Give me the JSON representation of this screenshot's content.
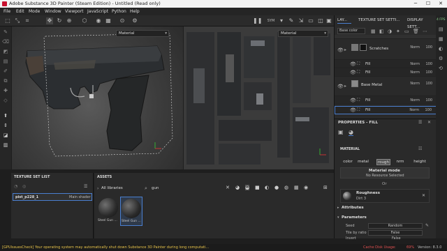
{
  "window": {
    "title": "Adobe Substance 3D Painter (Steam Edition) - Untitled (Read only)",
    "minimize": "─",
    "maximize": "☐",
    "close": "✕"
  },
  "menu": [
    "File",
    "Edit",
    "Mode",
    "Window",
    "Viewport",
    "JavaScript",
    "Python",
    "Help"
  ],
  "viewport3d": {
    "channel_select": "Material"
  },
  "viewport2d": {
    "channel_select": "Material"
  },
  "toolbar": {
    "sym_label": "SYM"
  },
  "layers": {
    "tabs": [
      "LAY...",
      "TEXTURE SET SETTI...",
      "DISPLAY SETT..."
    ],
    "channel_select": "Base color",
    "fps": "4 FPS",
    "rows": [
      {
        "name": "Scratches",
        "blend": "Norm",
        "opacity": "100"
      },
      {
        "name": "Fill",
        "blend": "Norm",
        "opacity": "100"
      },
      {
        "name": "Fill",
        "blend": "Norm",
        "opacity": "100"
      },
      {
        "name": "Base Metal",
        "blend": "Norm",
        "opacity": "100"
      },
      {
        "name": "Fill",
        "blend": "Norm",
        "opacity": "100"
      },
      {
        "name": "Fill",
        "blend": "Norm",
        "opacity": "100"
      }
    ]
  },
  "properties": {
    "title": "PROPERTIES - FILL",
    "material_label": "MATERIAL",
    "channels": [
      "color",
      "metal",
      "rough",
      "nrm",
      "height"
    ],
    "material_mode": "Material mode",
    "no_resource": "No Resource Selected",
    "or_label": "Or",
    "roughness_label": "Roughness",
    "roughness_value": "Dirt 3",
    "attributes_label": "Attributes",
    "parameters_label": "Parameters",
    "seed_label": "Seed",
    "seed_value": "Random",
    "tile_label": "Tile by ratio",
    "tile_value": "False",
    "invert_label": "Invert",
    "invert_value": "False"
  },
  "texture_set_list": {
    "title": "TEXTURE SET LIST",
    "item": "pist_p228_1",
    "shader": "Main shader"
  },
  "assets": {
    "title": "ASSETS",
    "library": "All libraries",
    "search": "gun",
    "items": [
      "Steel Gun ...",
      "Steel Gun ..."
    ]
  },
  "status": {
    "message": "[GPUIssuesCheck] Your operating system may automatically shut down Substance 3D Painter during long computati...",
    "cache": "Cache Disk Usage:",
    "cache_pct": "69%",
    "version": "Version: 8.3.0"
  }
}
